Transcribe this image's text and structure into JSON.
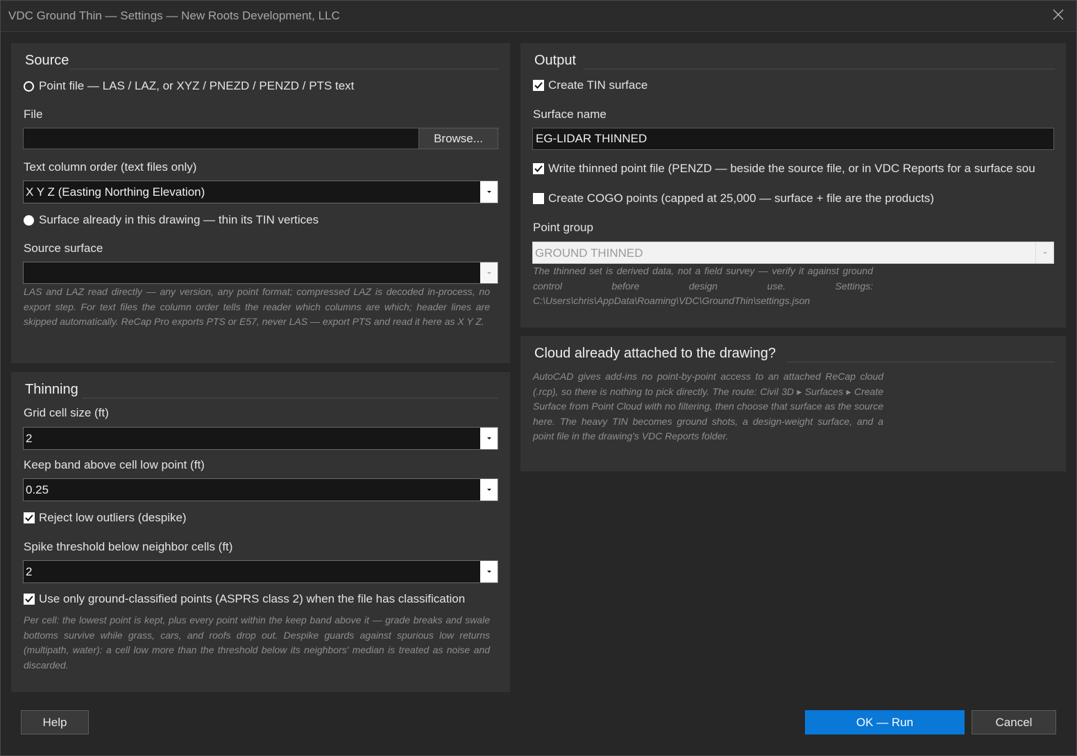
{
  "window": {
    "title": "VDC Ground Thin — Settings — New Roots Development, LLC"
  },
  "source": {
    "heading": "Source",
    "point_file_option": "Point file — LAS / LAZ, or XYZ / PNEZD / PENZD / PTS text",
    "file_label": "File",
    "file_value": "",
    "browse_label": "Browse...",
    "column_order_label": "Text column order (text files only)",
    "column_order_value": "X Y Z  (Easting Northing Elevation)",
    "surface_option": "Surface already in this drawing — thin its TIN vertices",
    "source_surface_label": "Source surface",
    "source_surface_value": "",
    "note": "LAS and LAZ read directly — any version, any point format; compressed LAZ is decoded in-process, no export step. For text files the column order tells the reader which columns are which; header lines are skipped automatically. ReCap Pro exports PTS or E57, never LAS — export PTS and read it here as X Y Z."
  },
  "thinning": {
    "heading": "Thinning",
    "grid_cell_label": "Grid cell size (ft)",
    "grid_cell_value": "2",
    "keep_band_label": "Keep band above cell low point (ft)",
    "keep_band_value": "0.25",
    "despike_label": "Reject low outliers (despike)",
    "despike_checked": true,
    "spike_label": "Spike threshold below neighbor cells (ft)",
    "spike_value": "2",
    "ground_class_label": "Use only ground-classified points (ASPRS class 2) when the file has classification",
    "ground_class_checked": true,
    "note": "Per cell: the lowest point is kept, plus every point within the keep band above it — grade breaks and swale bottoms survive while grass, cars, and roofs drop out. Despike guards against spurious low returns (multipath, water): a cell low more than the threshold below its neighbors' median is treated as noise and discarded."
  },
  "output": {
    "heading": "Output",
    "create_tin_label": "Create TIN surface",
    "create_tin_checked": true,
    "surface_name_label": "Surface name",
    "surface_name_value": "EG-LIDAR THINNED",
    "write_file_label": "Write thinned point file (PENZD — beside the source file, or in VDC Reports for a surface sou",
    "write_file_checked": true,
    "cogo_label": "Create COGO points (capped at 25,000 — surface + file are the products)",
    "cogo_checked": false,
    "point_group_label": "Point group",
    "point_group_value": "GROUND THINNED",
    "note": "The thinned set is derived data, not a field survey — verify it against ground control before design use. Settings: C:\\Users\\chris\\AppData\\Roaming\\VDC\\GroundThin\\settings.json"
  },
  "cloud": {
    "heading": "Cloud already attached to the drawing?",
    "note": "AutoCAD gives add-ins no point-by-point access to an attached ReCap cloud (.rcp), so there is nothing to pick directly. The route: Civil 3D ▸ Surfaces ▸ Create Surface from Point Cloud with no filtering, then choose that surface as the source here. The heavy TIN becomes ground shots, a design-weight surface, and a point file in the drawing's VDC Reports folder."
  },
  "footer": {
    "help_label": "Help",
    "ok_label": "OK — Run",
    "cancel_label": "Cancel"
  },
  "colors": {
    "accent": "#0a78d7",
    "panel": "#333333",
    "window": "#272727"
  }
}
